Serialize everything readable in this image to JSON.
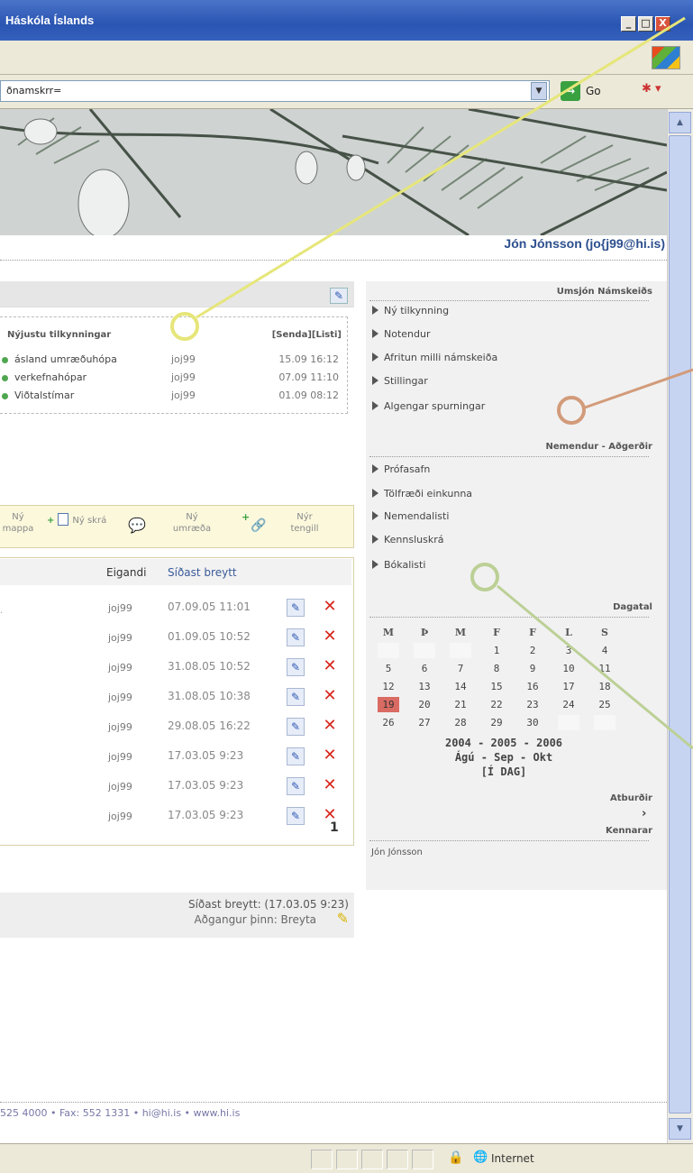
{
  "window": {
    "title": "Háskóla Íslands",
    "minimize": "_",
    "maximize": "□",
    "close": "X"
  },
  "address": {
    "value": "ðnamskrr=",
    "go_label": "Go"
  },
  "header": {
    "user_name": "Jón Jónsson (jo{j99@hi.is)"
  },
  "notices": {
    "heading": "Nýjustu tilkynningar",
    "actions": "[Senda][Listi]",
    "items": [
      {
        "title": "ásland umræðuhópa",
        "owner": "joj99",
        "date": "15.09 16:12"
      },
      {
        "title": "verkefnahópar",
        "owner": "joj99",
        "date": "07.09 11:10"
      },
      {
        "title": "Viðtalstímar",
        "owner": "joj99",
        "date": "01.09 08:12"
      }
    ]
  },
  "toolbar": {
    "new_folder_top": "Ný",
    "new_folder_bottom": "mappa",
    "new_file": "Ný skrá",
    "new_discussion_top": "Ný",
    "new_discussion_bottom": "umræða",
    "new_link_top": "Nýr",
    "new_link_bottom": "tengill"
  },
  "files": {
    "col_owner": "Eigandi",
    "col_modified": "Síðast breytt",
    "rows": [
      {
        "owner": "joj99",
        "modified": "07.09.05 11:01"
      },
      {
        "owner": "joj99",
        "modified": "01.09.05 10:52"
      },
      {
        "owner": "joj99",
        "modified": "31.08.05 10:52"
      },
      {
        "owner": "joj99",
        "modified": "31.08.05 10:38"
      },
      {
        "owner": "joj99",
        "modified": "29.08.05 16:22"
      },
      {
        "owner": "joj99",
        "modified": "17.03.05 9:23"
      },
      {
        "owner": "joj99",
        "modified": "17.03.05 9:23"
      },
      {
        "owner": "joj99",
        "modified": "17.03.05 9:23"
      }
    ],
    "page": "1"
  },
  "lastmod": {
    "line1": "Síðast breytt: (17.03.05 9:23)",
    "line2": "Aðgangur þinn: Breyta"
  },
  "admin": {
    "heading": "Umsjón Námskeiðs",
    "items": [
      "Ný tilkynning",
      "Notendur",
      "Afritun milli námskeiða",
      "Stillingar",
      "Algengar spurningar"
    ]
  },
  "students": {
    "heading": "Nemendur - Aðgerðir",
    "items": [
      "Prófasafn",
      "Tölfræði einkunna",
      "Nemendalisti",
      "Kennsluskrá",
      "Bókalisti"
    ]
  },
  "calendar": {
    "heading": "Dagatal",
    "weekdays": [
      "M",
      "Þ",
      "M",
      "F",
      "F",
      "L",
      "S"
    ],
    "weeks": [
      [
        "",
        "",
        "",
        "1",
        "2",
        "3",
        "4"
      ],
      [
        "5",
        "6",
        "7",
        "8",
        "9",
        "10",
        "11"
      ],
      [
        "12",
        "13",
        "14",
        "15",
        "16",
        "17",
        "18"
      ],
      [
        "19",
        "20",
        "21",
        "22",
        "23",
        "24",
        "25"
      ],
      [
        "26",
        "27",
        "28",
        "29",
        "30",
        "",
        ""
      ]
    ],
    "today": "19",
    "years": "2004 - 2005 - 2006",
    "months": "Ágú - Sep - Okt",
    "today_link": "[Í DAG]",
    "events_label": "Atburðir",
    "events_more": "›"
  },
  "teachers": {
    "heading": "Kennarar",
    "name": "Jón Jónsson"
  },
  "footer": {
    "contact": "525 4000 • Fax: 552 1331 • hi@hi.is • www.hi.is"
  },
  "status": {
    "zone": "Internet"
  },
  "colors": {
    "accent": "#2c4f8e",
    "today": "#d96b63",
    "delete": "#d8261b"
  }
}
